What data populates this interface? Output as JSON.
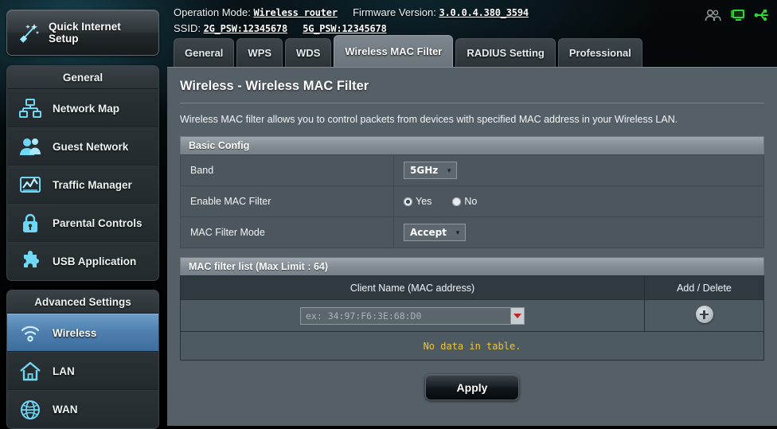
{
  "header": {
    "operation_mode_label": "Operation Mode:",
    "operation_mode_value": "Wireless router",
    "firmware_label": "Firmware Version:",
    "firmware_value": "3.0.0.4.380_3594",
    "ssid_label": "SSID:",
    "ssid_2g": "2G_PSW:12345678",
    "ssid_5g": "5G_PSW:12345678",
    "icons": [
      {
        "name": "clients-icon",
        "title": "Clients"
      },
      {
        "name": "monitor-icon",
        "title": "Connected device"
      },
      {
        "name": "usb-icon",
        "title": "USB"
      }
    ]
  },
  "sidebar": {
    "quick_setup_label": "Quick Internet Setup",
    "general_title": "General",
    "general_items": [
      {
        "label": "Network Map",
        "icon": "network-map-icon",
        "active": false
      },
      {
        "label": "Guest Network",
        "icon": "guest-network-icon",
        "active": false
      },
      {
        "label": "Traffic Manager",
        "icon": "traffic-manager-icon",
        "active": false
      },
      {
        "label": "Parental Controls",
        "icon": "parental-controls-icon",
        "active": false
      },
      {
        "label": "USB Application",
        "icon": "usb-application-icon",
        "active": false
      }
    ],
    "advanced_title": "Advanced Settings",
    "advanced_items": [
      {
        "label": "Wireless",
        "icon": "wireless-icon",
        "active": true
      },
      {
        "label": "LAN",
        "icon": "lan-icon",
        "active": false
      },
      {
        "label": "WAN",
        "icon": "wan-icon",
        "active": false
      }
    ]
  },
  "tabs": [
    {
      "label": "General",
      "active": false
    },
    {
      "label": "WPS",
      "active": false
    },
    {
      "label": "WDS",
      "active": false
    },
    {
      "label": "Wireless MAC Filter",
      "active": true
    },
    {
      "label": "RADIUS Setting",
      "active": false
    },
    {
      "label": "Professional",
      "active": false
    }
  ],
  "main": {
    "title": "Wireless - Wireless MAC Filter",
    "description": "Wireless MAC filter allows you to control packets from devices with specified MAC address in your Wireless LAN.",
    "basic_config": {
      "section_title": "Basic Config",
      "band_label": "Band",
      "band_value": "5GHz",
      "enable_label": "Enable MAC Filter",
      "enable_yes": "Yes",
      "enable_no": "No",
      "enable_selected": "Yes",
      "mode_label": "MAC Filter Mode",
      "mode_value": "Accept"
    },
    "mac_list": {
      "section_title": "MAC filter list (Max Limit : 64)",
      "col_client": "Client Name (MAC address)",
      "col_add": "Add / Delete",
      "input_value": "",
      "input_placeholder": "ex: 34:97:F6:3E:68:D0",
      "empty_text": "No data in table."
    },
    "apply_label": "Apply"
  },
  "colors": {
    "accent_blue": "#4f81b0",
    "panel": "#555f66",
    "warning_yellow": "#ebc53c",
    "dropdown_red": "#c0232a",
    "icon_cyan": "#66d9f2",
    "icon_green": "#2fd62f"
  }
}
